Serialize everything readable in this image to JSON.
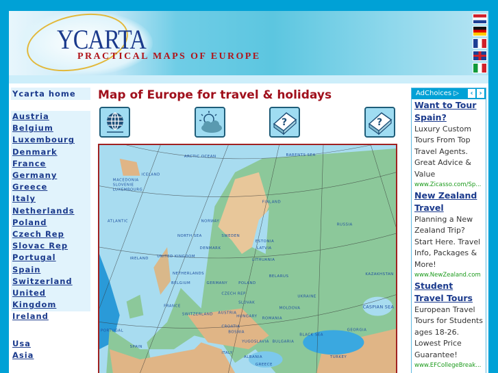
{
  "header": {
    "logo": "YCARTA",
    "tagline": "PRACTICAL MAPS OF EUROPE",
    "flags": [
      {
        "name": "netherlands",
        "colors": [
          "#d0202a",
          "#ffffff",
          "#1c3f94"
        ]
      },
      {
        "name": "germany",
        "colors": [
          "#111111",
          "#dd0000",
          "#ffcc00"
        ]
      },
      {
        "name": "france",
        "colors": [
          "#1c3f94",
          "#ffffff",
          "#d0202a"
        ]
      },
      {
        "name": "united-kingdom",
        "colors": [
          "#1c3f94",
          "#ffffff",
          "#d0202a"
        ]
      },
      {
        "name": "italy",
        "colors": [
          "#119a3a",
          "#ffffff",
          "#d0202a"
        ]
      }
    ]
  },
  "sidebar": {
    "home": "Ycarta home",
    "countries": [
      "Austria",
      "Belgium",
      "Luxembourg",
      "Denmark",
      "France",
      "Germany",
      "Greece",
      "Italy",
      "Netherlands",
      "Poland",
      "Czech Rep",
      "Slovac Rep",
      "Portugal",
      "Spain",
      "Switzerland",
      "United Kingdom",
      "Ireland"
    ],
    "other": [
      "Usa",
      "Asia"
    ]
  },
  "main": {
    "title": "Map of Europe for travel & holidays",
    "icons": [
      "globe-icon",
      "weather-icon",
      "help-box-icon",
      "help-box-icon"
    ],
    "map_labels": [
      "ARCTIC OCEAN",
      "BARENTS SEA",
      "ICELAND",
      "ATLANTIC",
      "NORWAY",
      "FINLAND",
      "RUSSIA",
      "SWEDEN",
      "NORTH SEA",
      "ESTONIA",
      "LATVIA",
      "DENMARK",
      "UNITED KINGDOM",
      "IRELAND",
      "LITHUANIA",
      "NETHERLANDS",
      "BELARUS",
      "BELGIUM",
      "GERMANY",
      "POLAND",
      "KAZAKHSTAN",
      "CZECH REP",
      "UKRAINE",
      "FRANCE",
      "SLOVAK",
      "MOLDOVA",
      "SWITZERLAND",
      "AUSTRIA",
      "HUNGARY",
      "ROMANIA",
      "CASPIAN SEA",
      "CROATIA",
      "BOSNIA",
      "BLACK SEA",
      "GEORGIA",
      "PORTUGAL",
      "SPAIN",
      "YUGOSLAVIA",
      "BULGARIA",
      "ITALY",
      "ALBANIA",
      "TURKEY",
      "GREECE",
      "MACEDONIA",
      "SLOVENIE",
      "LUXEMBOURG"
    ]
  },
  "ads": {
    "label": "AdChoices",
    "items": [
      {
        "title": "Want to Tour Spain?",
        "text": "Luxury Custom Tours From Top Travel Agents. Great Advice & Value",
        "url": "www.Zicasso.com/Sp..."
      },
      {
        "title": "New Zealand Travel",
        "text": "Planning a New Zealand Trip? Start Here. Travel Info, Packages & More!",
        "url": "www.NewZealand.com"
      },
      {
        "title": "Student Travel Tours",
        "text": "European Travel Tours for Students ages 18-26. Lowest Price Guarantee!",
        "url": "www.EFCollegeBreak..."
      }
    ]
  },
  "colors": {
    "background": "#00a1d6",
    "title": "#a0101c",
    "link": "#1b3a8c",
    "ad_url": "#1a9a1a"
  }
}
